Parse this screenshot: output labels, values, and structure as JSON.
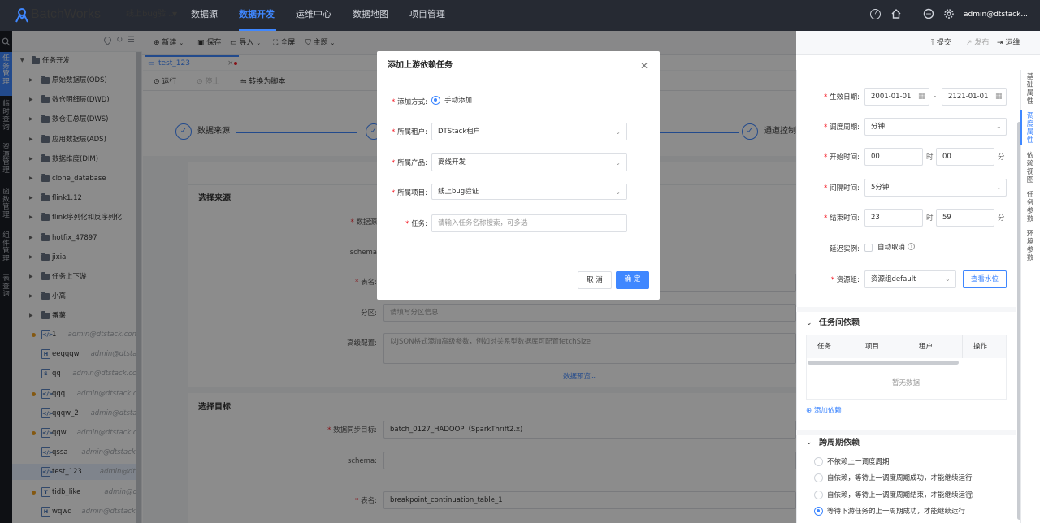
{
  "topbar": {
    "brand": "BatchWorks",
    "project": "线上bug验...",
    "nav": [
      "数据源",
      "数据开发",
      "运维中心",
      "数据地图",
      "项目管理"
    ],
    "user": "admin@dtstack...",
    "accent": "#3f87ff"
  },
  "left_rail": [
    "任务管理",
    "临时查询",
    "资源管理",
    "函数管理",
    "组件管理",
    "表查询"
  ],
  "toolbar": {
    "new": "新建",
    "save": "保存",
    "import": "导入",
    "fullscreen": "全屏",
    "theme": "主题",
    "submit": "提交",
    "publish": "发布",
    "ops": "运维"
  },
  "tree": {
    "root": "任务开发",
    "folders": [
      "原始数据层(ODS)",
      "数仓明细层(DWD)",
      "数仓汇总层(DWS)",
      "应用数据层(ADS)",
      "数据维度(DIM)",
      "clone_database",
      "flink1.12",
      "flink序列化和反序列化",
      "hotfix_47897",
      "jixia",
      "任务上下游",
      "小高",
      "番薯"
    ],
    "files": [
      {
        "name": "1",
        "meta": "admin@dtstack.com 锁...",
        "type": "</>",
        "dot": true
      },
      {
        "name": "eeqqqw",
        "meta": "admin@dtstack...",
        "type": "H",
        "dot": false
      },
      {
        "name": "qq",
        "meta": "admin@dtstack.com",
        "type": "S",
        "dot": false
      },
      {
        "name": "qqq",
        "meta": "admin@dtstack.com...",
        "type": "</>",
        "dot": true
      },
      {
        "name": "qqqw_2",
        "meta": "admin@dtstack.com",
        "type": "</>",
        "dot": false
      },
      {
        "name": "qqw",
        "meta": "admin@dtstack.com...",
        "type": "</>",
        "dot": true
      },
      {
        "name": "qssa",
        "meta": "admin@dtstack.co...",
        "type": "</>",
        "dot": false
      },
      {
        "name": "test_123",
        "meta": "admin@dtstack....",
        "type": "</>",
        "dot": false
      },
      {
        "name": "tidb_like",
        "meta": "admin@dtstack.com...",
        "type": "T",
        "dot": true
      },
      {
        "name": "wqwq",
        "meta": "admin@dtstack.co...",
        "type": "H",
        "dot": false
      }
    ]
  },
  "editor": {
    "tab": "test_123",
    "run": "运行",
    "stop": "停止",
    "to_script": "转换为脚本",
    "steps": [
      "数据来源",
      "通道控制"
    ],
    "source": {
      "title": "选择来源",
      "datasource_label": "数据源",
      "schema_label": "schema",
      "table_label": "表名",
      "partition_label": "分区",
      "partition_placeholder": "请填写分区信息",
      "advanced_label": "高级配置",
      "advanced_placeholder": "以JSON格式添加高级参数，例如对关系型数据库可配置fetchSize",
      "preview": "数据预览"
    },
    "target": {
      "title": "选择目标",
      "sync_label": "数据同步目标",
      "sync_value": "batch_0127_HADOOP（SparkThrift2.x)",
      "schema_label": "schema",
      "table_label": "表名",
      "table_value": "breakpoint_continuation_table_1"
    }
  },
  "schedule": {
    "effective_label": "生效日期",
    "date_from": "2001-01-01",
    "date_to": "2121-01-01",
    "period_label": "调度周期",
    "period_value": "分钟",
    "start_label": "开始时间",
    "start_h": "00",
    "start_m": "00",
    "hour_unit": "时",
    "min_unit": "分",
    "interval_label": "间隔时间",
    "interval_value": "5分钟",
    "end_label": "结束时间",
    "end_h": "23",
    "end_m": "59",
    "delay_label": "延迟实例",
    "auto_cancel": "自动取消",
    "resource_label": "资源组",
    "resource_value": "资源组default",
    "water_btn": "查看水位",
    "dep_title": "任务间依赖",
    "dep_cols": [
      "任务",
      "项目",
      "租户",
      "操作"
    ],
    "dep_empty": "暂无数据",
    "add_dep": "添加依赖",
    "cross_title": "跨周期依赖",
    "cross_options": [
      "不依赖上一调度周期",
      "自依赖，等待上一调度周期成功，才能继续运行",
      "自依赖，等待上一调度周期结束，才能继续运行",
      "等待下游任务的上一周期成功，才能继续运行"
    ]
  },
  "right_tabs": [
    "基础属性",
    "调度属性",
    "依赖视图",
    "任务参数",
    "环境参数"
  ],
  "modal": {
    "title": "添加上游依赖任务",
    "add_mode_label": "添加方式",
    "add_mode_value": "手动添加",
    "tenant_label": "所属租户",
    "tenant_value": "DTStack租户",
    "product_label": "所属产品",
    "product_value": "离线开发",
    "project_label": "所属项目",
    "project_value": "线上bug验证",
    "task_label": "任务",
    "task_placeholder": "请输入任务名称搜索，可多选",
    "cancel": "取 消",
    "ok": "确 定"
  }
}
